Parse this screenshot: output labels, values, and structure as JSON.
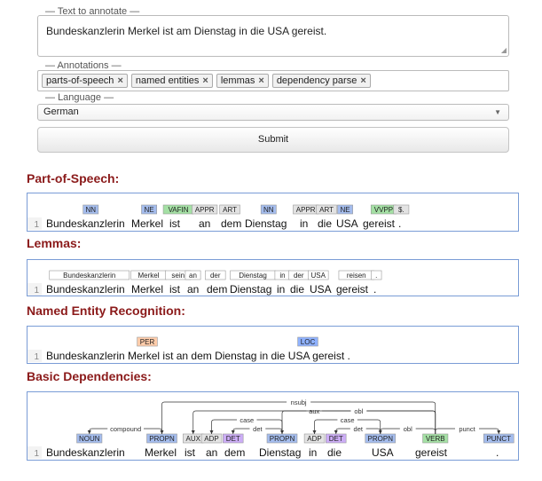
{
  "form": {
    "text_legend": "Text to annotate",
    "text_value": "Bundeskanzlerin Merkel ist am Dienstag in die USA gereist.",
    "annotations_legend": "Annotations",
    "annotations": [
      {
        "label": "parts-of-speech",
        "remove": "×"
      },
      {
        "label": "named entities",
        "remove": "×"
      },
      {
        "label": "lemmas",
        "remove": "×"
      },
      {
        "label": "dependency parse",
        "remove": "×"
      }
    ],
    "language_legend": "Language",
    "language_value": "German",
    "submit_label": "Submit"
  },
  "sections": {
    "pos_title": "Part-of-Speech:",
    "lemmas_title": "Lemmas:",
    "ner_title": "Named Entity Recognition:",
    "deps_title": "Basic Dependencies:"
  },
  "sentence": {
    "line_number": "1",
    "tokens": [
      "Bundeskanzlerin",
      "Merkel",
      "ist",
      "an",
      "dem",
      "Dienstag",
      "in",
      "die",
      "USA",
      "gereist",
      "."
    ],
    "lemma_row_tokens": [
      "Bundeskanzlerin",
      "Merkel",
      "ist",
      "an",
      "dem",
      "Dienstag",
      "in",
      "die",
      "USA",
      "gereist",
      "."
    ],
    "ner_row_text": "Bundeskanzlerin Merkel ist an dem Dienstag in die USA gereist ."
  },
  "pos_tags": [
    "NN",
    "NE",
    "VAFIN",
    "APPR",
    "ART",
    "NN",
    "APPR",
    "ART",
    "NE",
    "VVPP",
    "$."
  ],
  "lemmas": [
    "Bundeskanzlerin",
    "Merkel",
    "sein",
    "an",
    "der",
    "Dienstag",
    "in",
    "der",
    "USA",
    "reisen",
    "."
  ],
  "entities": [
    {
      "label": "PER",
      "color": "#ffccaa"
    },
    {
      "label": "LOC",
      "color": "#8fb2ff"
    }
  ],
  "dependencies": {
    "tokens": [
      "Bundeskanzlerin",
      "Merkel",
      "ist",
      "an",
      "dem",
      "Dienstag",
      "in",
      "die",
      "USA",
      "gereist",
      "."
    ],
    "tags": [
      "NOUN",
      "PROPN",
      "AUX",
      "ADP",
      "DET",
      "PROPN",
      "ADP",
      "DET",
      "PROPN",
      "VERB",
      "PUNCT"
    ],
    "arc_labels": [
      "compound",
      "nsubj",
      "aux",
      "case",
      "det",
      "obl",
      "case",
      "det",
      "obl",
      "punct"
    ]
  },
  "colors": {
    "section_title": "#8b1a1a",
    "panel_border": "#7a9cd6",
    "noun_tag": "#a4bced",
    "verb_tag": "#a4e0a4",
    "other_tag": "#e3e3e3",
    "det_tag": "#ccadf6",
    "per": "#ffccaa",
    "loc": "#8fb2ff"
  }
}
